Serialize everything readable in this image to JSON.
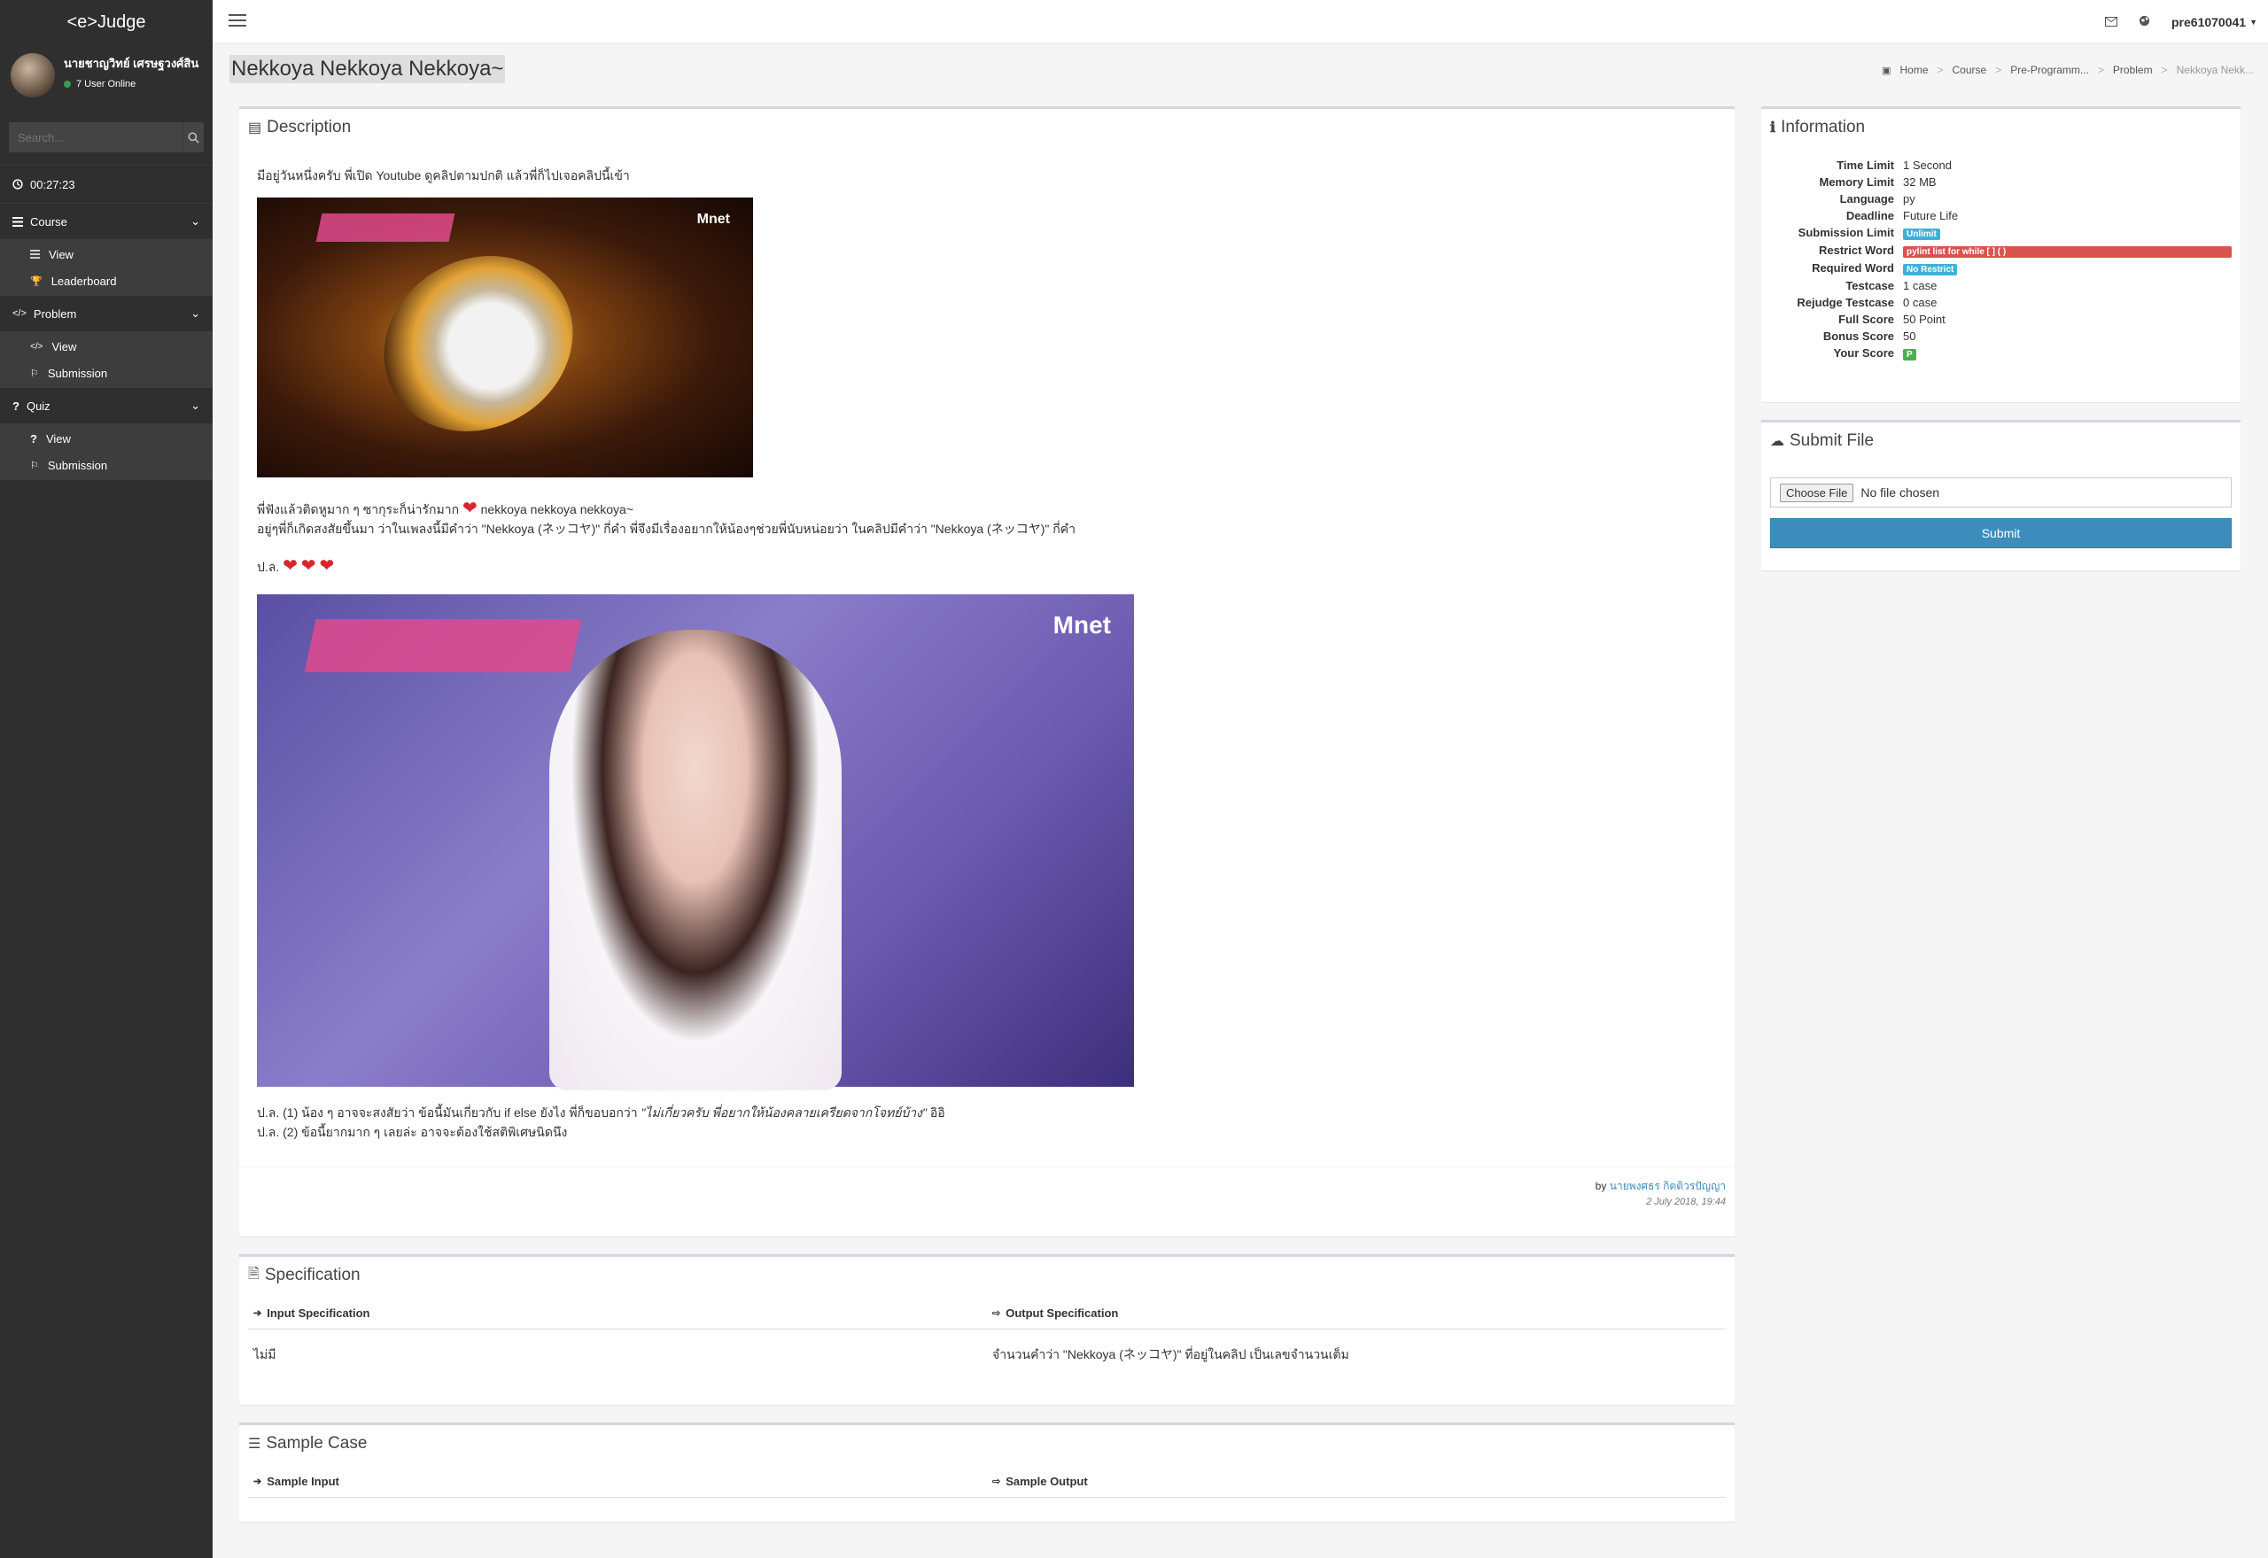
{
  "app": {
    "brand": "<e>Judge"
  },
  "user": {
    "name": "นายชาญวิทย์ เศรษฐวงศ์สิน",
    "status": "7 User Online"
  },
  "search": {
    "placeholder": "Search..."
  },
  "timer": "00:27:23",
  "menu": {
    "course": {
      "label": "Course",
      "items": [
        "View",
        "Leaderboard"
      ]
    },
    "problem": {
      "label": "Problem",
      "items": [
        "View",
        "Submission"
      ]
    },
    "quiz": {
      "label": "Quiz",
      "items": [
        "View",
        "Submission"
      ]
    }
  },
  "topbar": {
    "username": "pre61070041"
  },
  "page": {
    "title": "Nekkoya Nekkoya Nekkoya~"
  },
  "breadcrumb": [
    "Home",
    "Course",
    "Pre-Programm...",
    "Problem",
    "Nekkoya Nekk..."
  ],
  "description": {
    "header": "Description",
    "intro": "มีอยู่วันหนึ่งครับ พี่เปิด Youtube ดูคลิปตามปกติ แล้วพี่ก็ไปเจอคลิปนี้เข้า",
    "img1_logo": "Mnet",
    "img2_logo": "Mnet",
    "p1_line1_a": "พี่ฟังแล้วติดหูมาก ๆ ซากุระก็น่ารักมาก",
    "p1_line1_b": "nekkoya nekkoya nekkoya~",
    "p1_line2": "อยู่ๆพี่ก็เกิดสงสัยขึ้นมา ว่าในเพลงนี้มีคำว่า \"Nekkoya (ネッコヤ)\" กี่คำ พี่จึงมีเรื่องอยากให้น้องๆช่วยพี่นับหน่อยว่า ในคลิปมีคำว่า \"Nekkoya (ネッコヤ)\" กี่คำ",
    "ps_label": "ป.ล.",
    "ps1_a": "ป.ล. (1) น้อง ๆ อาจจะสงสัยว่า ข้อนี้มันเกี่ยวกับ if else ยังไง พี่ก็ขอบอกว่า",
    "ps1_italic": "\"ไม่เกี่ยวครับ พี่อยากให้น้องคลายเครียดจากโจทย์บ้าง\"",
    "ps1_b": "อิอิ",
    "ps2": "ป.ล. (2) ข้อนี้ยากมาก ๆ เลยล่ะ อาจจะต้องใช้สติพิเศษนิดนึง",
    "by_label": "by",
    "author": "นายพงศธร กิตติวรปัญญา",
    "date": "2 July 2018, 19:44"
  },
  "information": {
    "header": "Information",
    "rows": [
      {
        "k": "Time Limit",
        "v": "1 Second"
      },
      {
        "k": "Memory Limit",
        "v": "32 MB"
      },
      {
        "k": "Language",
        "v": "py"
      },
      {
        "k": "Deadline",
        "v": "Future Life"
      },
      {
        "k": "Submission Limit",
        "v": "Unlimit",
        "badge": "blue"
      },
      {
        "k": "Restrict Word",
        "v": "pylint list for while [ ] ( )",
        "badge": "red"
      },
      {
        "k": "Required Word",
        "v": "No Restrict",
        "badge": "blue"
      },
      {
        "k": "Testcase",
        "v": "1 case"
      },
      {
        "k": "Rejudge Testcase",
        "v": "0 case"
      },
      {
        "k": "Full Score",
        "v": "50 Point"
      },
      {
        "k": "Bonus Score",
        "v": "50"
      },
      {
        "k": "Your Score",
        "v": "P",
        "badge": "green"
      }
    ]
  },
  "submit": {
    "header": "Submit File",
    "choose": "Choose File",
    "nofile": "No file chosen",
    "button": "Submit"
  },
  "specification": {
    "header": "Specification",
    "input_label": "Input Specification",
    "output_label": "Output Specification",
    "input_value": "ไม่มี",
    "output_value": "จำนวนคำว่า \"Nekkoya (ネッコヤ)\" ที่อยู่ในคลิป เป็นเลขจำนวนเต็ม"
  },
  "sample": {
    "header": "Sample Case",
    "input_label": "Sample Input",
    "output_label": "Sample Output"
  },
  "colors": {
    "sidebar": "#2f2f2f",
    "accent": "#3c8dbc",
    "danger": "#d9534f",
    "info": "#3fb1d9",
    "success": "#4caf50"
  }
}
